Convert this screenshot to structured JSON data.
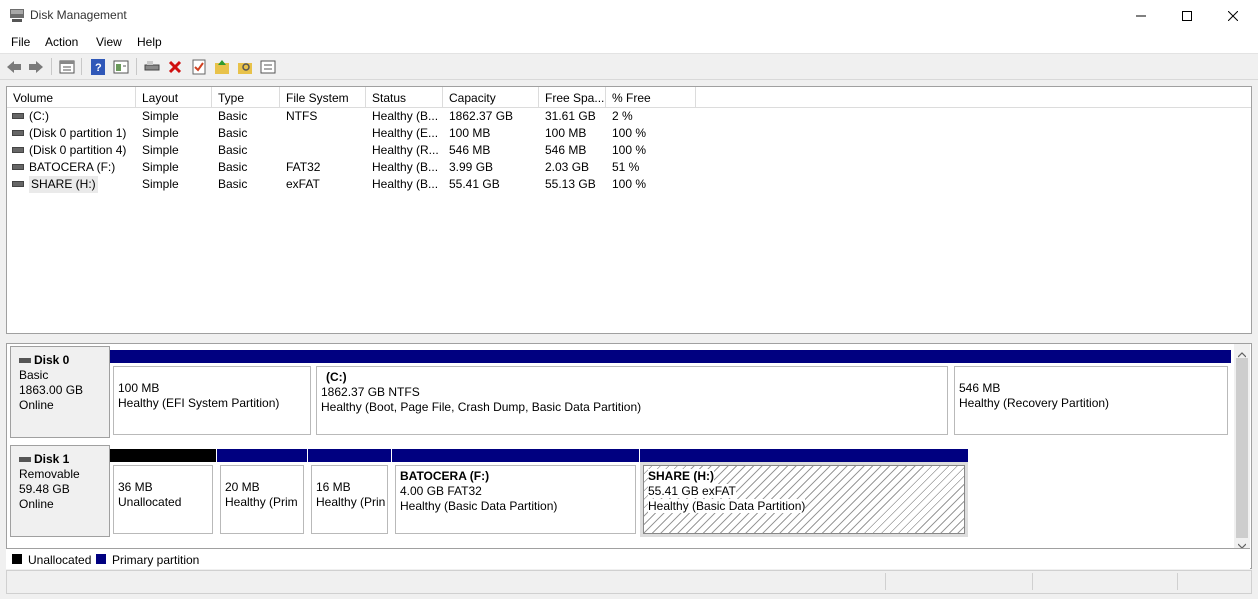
{
  "window": {
    "title": "Disk Management",
    "minimize": "—",
    "maximize": "☐",
    "close": "✕"
  },
  "menu": [
    "File",
    "Action",
    "View",
    "Help"
  ],
  "toolbar_icons": [
    "back-icon",
    "forward-icon",
    "properties-icon",
    "help-icon",
    "view-icon",
    "connect-icon",
    "delete-icon",
    "check-icon",
    "folder-up-icon",
    "search-folder-icon",
    "settings-icon"
  ],
  "columns": [
    "Volume",
    "Layout",
    "Type",
    "File System",
    "Status",
    "Capacity",
    "Free Spa...",
    "% Free"
  ],
  "volumes": [
    {
      "volume": "(C:)",
      "layout": "Simple",
      "type": "Basic",
      "fs": "NTFS",
      "status": "Healthy (B...",
      "capacity": "1862.37 GB",
      "free": "31.61 GB",
      "pct": "2 %"
    },
    {
      "volume": "(Disk 0 partition 1)",
      "layout": "Simple",
      "type": "Basic",
      "fs": "",
      "status": "Healthy (E...",
      "capacity": "100 MB",
      "free": "100 MB",
      "pct": "100 %"
    },
    {
      "volume": "(Disk 0 partition 4)",
      "layout": "Simple",
      "type": "Basic",
      "fs": "",
      "status": "Healthy (R...",
      "capacity": "546 MB",
      "free": "546 MB",
      "pct": "100 %"
    },
    {
      "volume": "BATOCERA (F:)",
      "layout": "Simple",
      "type": "Basic",
      "fs": "FAT32",
      "status": "Healthy (B...",
      "capacity": "3.99 GB",
      "free": "2.03 GB",
      "pct": "51 %"
    },
    {
      "volume": "SHARE (H:)",
      "layout": "Simple",
      "type": "Basic",
      "fs": "exFAT",
      "status": "Healthy (B...",
      "capacity": "55.41 GB",
      "free": "55.13 GB",
      "pct": "100 %"
    }
  ],
  "disks": [
    {
      "name": "Disk 0",
      "type": "Basic",
      "size": "1863.00 GB",
      "state": "Online",
      "partitions": [
        {
          "name": "",
          "line1": "100 MB",
          "line2": "Healthy (EFI System Partition)",
          "kind": "primary"
        },
        {
          "name": "(C:)",
          "line1": "1862.37 GB NTFS",
          "line2": "Healthy (Boot, Page File, Crash Dump, Basic Data Partition)",
          "kind": "primary"
        },
        {
          "name": "",
          "line1": "546 MB",
          "line2": "Healthy (Recovery Partition)",
          "kind": "primary"
        }
      ]
    },
    {
      "name": "Disk 1",
      "type": "Removable",
      "size": "59.48 GB",
      "state": "Online",
      "partitions": [
        {
          "name": "",
          "line1": "36 MB",
          "line2": "Unallocated",
          "kind": "unallocated"
        },
        {
          "name": "",
          "line1": "20 MB",
          "line2": "Healthy (Prim",
          "kind": "primary"
        },
        {
          "name": "",
          "line1": "16 MB",
          "line2": "Healthy (Prin",
          "kind": "primary"
        },
        {
          "name": "BATOCERA  (F:)",
          "line1": "4.00 GB FAT32",
          "line2": "Healthy (Basic Data Partition)",
          "kind": "primary"
        },
        {
          "name": "SHARE  (H:)",
          "line1": "55.41 GB exFAT",
          "line2": "Healthy (Basic Data Partition)",
          "kind": "primary",
          "selected": true
        }
      ]
    }
  ],
  "legend": [
    {
      "label": "Unallocated",
      "color": "#000000"
    },
    {
      "label": "Primary partition",
      "color": "#000080"
    }
  ],
  "colors": {
    "primary": "#000080",
    "unallocated": "#000000"
  }
}
